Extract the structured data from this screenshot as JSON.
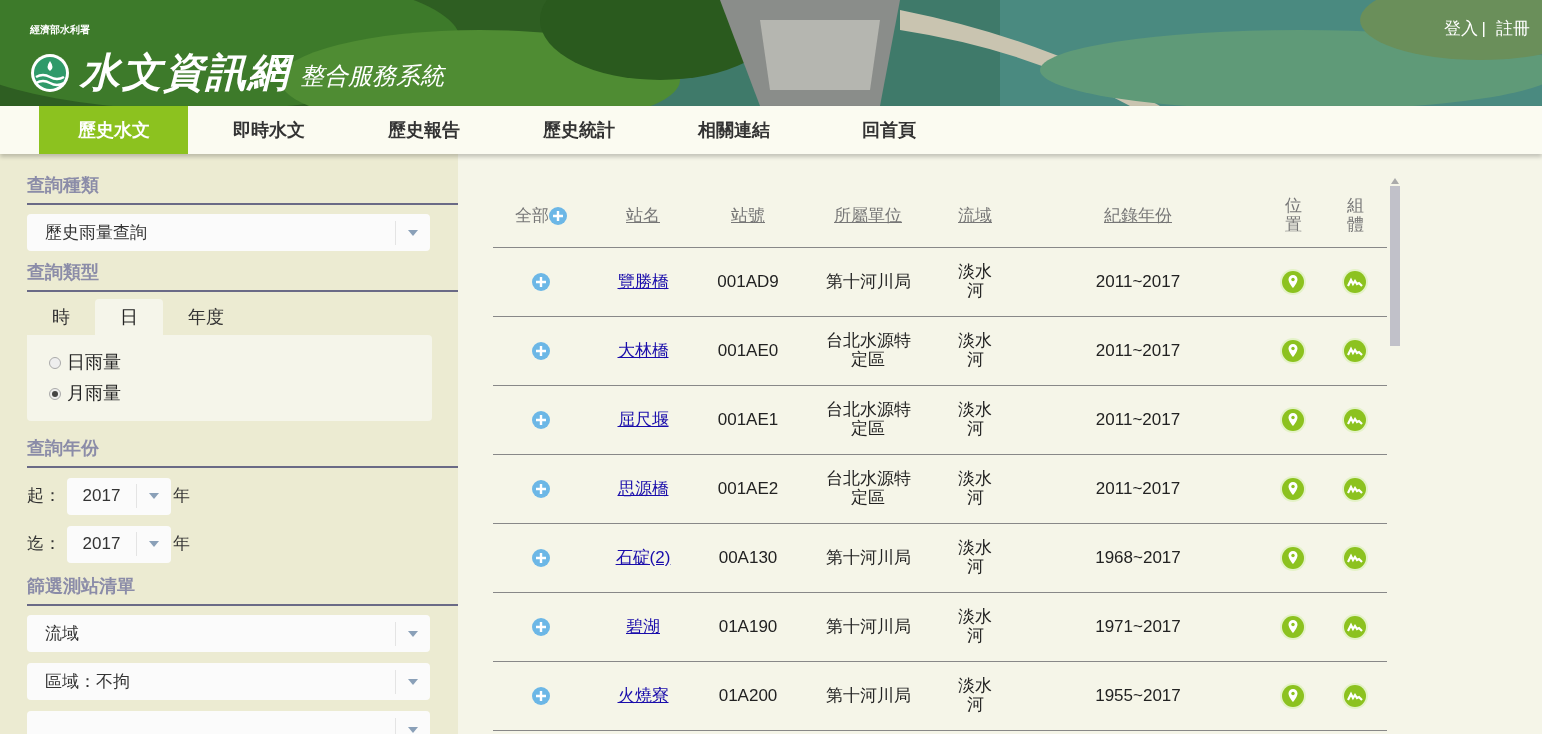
{
  "header": {
    "agency": "經濟部水利署",
    "title": "水文資訊網",
    "subtitle": "整合服務系統",
    "login": "登入",
    "separator": "|",
    "register": "註冊"
  },
  "nav": [
    {
      "label": "歷史水文",
      "selected": true
    },
    {
      "label": "即時水文",
      "selected": false
    },
    {
      "label": "歷史報告",
      "selected": false
    },
    {
      "label": "歷史統計",
      "selected": false
    },
    {
      "label": "相關連結",
      "selected": false
    },
    {
      "label": "回首頁",
      "selected": false
    }
  ],
  "sidebar": {
    "query_category": {
      "heading": "查詢種類",
      "value": "歷史雨量查詢"
    },
    "query_type": {
      "heading": "查詢類型",
      "tabs": [
        {
          "label": "時",
          "selected": false
        },
        {
          "label": "日",
          "selected": true
        },
        {
          "label": "年度",
          "selected": false
        }
      ],
      "options": [
        {
          "label": "日雨量",
          "selected": false
        },
        {
          "label": "月雨量",
          "selected": true
        }
      ]
    },
    "query_year": {
      "heading": "查詢年份",
      "rows": [
        {
          "label": "起：",
          "value": "2017",
          "unit": "年"
        },
        {
          "label": "迄：",
          "value": "2017",
          "unit": "年"
        }
      ]
    },
    "filter": {
      "heading": "篩選測站清單",
      "selects": [
        "流域",
        "區域：不拘"
      ]
    }
  },
  "table": {
    "all_label": "全部",
    "columns": [
      {
        "label": "站名",
        "sortable": true
      },
      {
        "label": "站號",
        "sortable": true
      },
      {
        "label": "所屬單位",
        "sortable": true
      },
      {
        "label": "流域",
        "sortable": true
      },
      {
        "label": "紀錄年份",
        "sortable": true
      },
      {
        "label": "位置",
        "sortable": false
      },
      {
        "label": "組體",
        "sortable": false
      }
    ],
    "rows": [
      {
        "name": "覽勝橋",
        "id": "001AD9",
        "unit": "第十河川局",
        "basin": "淡水河",
        "years": "2011~2017"
      },
      {
        "name": "大林橋",
        "id": "001AE0",
        "unit": "台北水源特定區",
        "basin": "淡水河",
        "years": "2011~2017"
      },
      {
        "name": "屈尺堰",
        "id": "001AE1",
        "unit": "台北水源特定區",
        "basin": "淡水河",
        "years": "2011~2017"
      },
      {
        "name": "思源橋",
        "id": "001AE2",
        "unit": "台北水源特定區",
        "basin": "淡水河",
        "years": "2011~2017"
      },
      {
        "name": "石碇(2)",
        "id": "00A130",
        "unit": "第十河川局",
        "basin": "淡水河",
        "years": "1968~2017"
      },
      {
        "name": "碧湖",
        "id": "01A190",
        "unit": "第十河川局",
        "basin": "淡水河",
        "years": "1971~2017"
      },
      {
        "name": "火燒寮",
        "id": "01A200",
        "unit": "第十河川局",
        "basin": "淡水河",
        "years": "1955~2017"
      }
    ]
  }
}
